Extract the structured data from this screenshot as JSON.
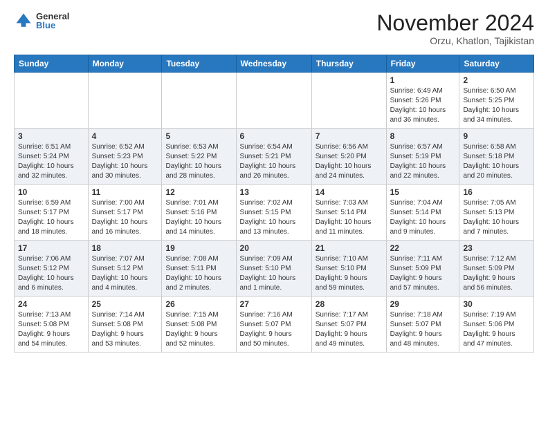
{
  "header": {
    "logo_general": "General",
    "logo_blue": "Blue",
    "month_title": "November 2024",
    "location": "Orzu, Khatlon, Tajikistan"
  },
  "weekdays": [
    "Sunday",
    "Monday",
    "Tuesday",
    "Wednesday",
    "Thursday",
    "Friday",
    "Saturday"
  ],
  "weeks": [
    [
      {
        "day": "",
        "info": ""
      },
      {
        "day": "",
        "info": ""
      },
      {
        "day": "",
        "info": ""
      },
      {
        "day": "",
        "info": ""
      },
      {
        "day": "",
        "info": ""
      },
      {
        "day": "1",
        "info": "Sunrise: 6:49 AM\nSunset: 5:26 PM\nDaylight: 10 hours\nand 36 minutes."
      },
      {
        "day": "2",
        "info": "Sunrise: 6:50 AM\nSunset: 5:25 PM\nDaylight: 10 hours\nand 34 minutes."
      }
    ],
    [
      {
        "day": "3",
        "info": "Sunrise: 6:51 AM\nSunset: 5:24 PM\nDaylight: 10 hours\nand 32 minutes."
      },
      {
        "day": "4",
        "info": "Sunrise: 6:52 AM\nSunset: 5:23 PM\nDaylight: 10 hours\nand 30 minutes."
      },
      {
        "day": "5",
        "info": "Sunrise: 6:53 AM\nSunset: 5:22 PM\nDaylight: 10 hours\nand 28 minutes."
      },
      {
        "day": "6",
        "info": "Sunrise: 6:54 AM\nSunset: 5:21 PM\nDaylight: 10 hours\nand 26 minutes."
      },
      {
        "day": "7",
        "info": "Sunrise: 6:56 AM\nSunset: 5:20 PM\nDaylight: 10 hours\nand 24 minutes."
      },
      {
        "day": "8",
        "info": "Sunrise: 6:57 AM\nSunset: 5:19 PM\nDaylight: 10 hours\nand 22 minutes."
      },
      {
        "day": "9",
        "info": "Sunrise: 6:58 AM\nSunset: 5:18 PM\nDaylight: 10 hours\nand 20 minutes."
      }
    ],
    [
      {
        "day": "10",
        "info": "Sunrise: 6:59 AM\nSunset: 5:17 PM\nDaylight: 10 hours\nand 18 minutes."
      },
      {
        "day": "11",
        "info": "Sunrise: 7:00 AM\nSunset: 5:17 PM\nDaylight: 10 hours\nand 16 minutes."
      },
      {
        "day": "12",
        "info": "Sunrise: 7:01 AM\nSunset: 5:16 PM\nDaylight: 10 hours\nand 14 minutes."
      },
      {
        "day": "13",
        "info": "Sunrise: 7:02 AM\nSunset: 5:15 PM\nDaylight: 10 hours\nand 13 minutes."
      },
      {
        "day": "14",
        "info": "Sunrise: 7:03 AM\nSunset: 5:14 PM\nDaylight: 10 hours\nand 11 minutes."
      },
      {
        "day": "15",
        "info": "Sunrise: 7:04 AM\nSunset: 5:14 PM\nDaylight: 10 hours\nand 9 minutes."
      },
      {
        "day": "16",
        "info": "Sunrise: 7:05 AM\nSunset: 5:13 PM\nDaylight: 10 hours\nand 7 minutes."
      }
    ],
    [
      {
        "day": "17",
        "info": "Sunrise: 7:06 AM\nSunset: 5:12 PM\nDaylight: 10 hours\nand 6 minutes."
      },
      {
        "day": "18",
        "info": "Sunrise: 7:07 AM\nSunset: 5:12 PM\nDaylight: 10 hours\nand 4 minutes."
      },
      {
        "day": "19",
        "info": "Sunrise: 7:08 AM\nSunset: 5:11 PM\nDaylight: 10 hours\nand 2 minutes."
      },
      {
        "day": "20",
        "info": "Sunrise: 7:09 AM\nSunset: 5:10 PM\nDaylight: 10 hours\nand 1 minute."
      },
      {
        "day": "21",
        "info": "Sunrise: 7:10 AM\nSunset: 5:10 PM\nDaylight: 9 hours\nand 59 minutes."
      },
      {
        "day": "22",
        "info": "Sunrise: 7:11 AM\nSunset: 5:09 PM\nDaylight: 9 hours\nand 57 minutes."
      },
      {
        "day": "23",
        "info": "Sunrise: 7:12 AM\nSunset: 5:09 PM\nDaylight: 9 hours\nand 56 minutes."
      }
    ],
    [
      {
        "day": "24",
        "info": "Sunrise: 7:13 AM\nSunset: 5:08 PM\nDaylight: 9 hours\nand 54 minutes."
      },
      {
        "day": "25",
        "info": "Sunrise: 7:14 AM\nSunset: 5:08 PM\nDaylight: 9 hours\nand 53 minutes."
      },
      {
        "day": "26",
        "info": "Sunrise: 7:15 AM\nSunset: 5:08 PM\nDaylight: 9 hours\nand 52 minutes."
      },
      {
        "day": "27",
        "info": "Sunrise: 7:16 AM\nSunset: 5:07 PM\nDaylight: 9 hours\nand 50 minutes."
      },
      {
        "day": "28",
        "info": "Sunrise: 7:17 AM\nSunset: 5:07 PM\nDaylight: 9 hours\nand 49 minutes."
      },
      {
        "day": "29",
        "info": "Sunrise: 7:18 AM\nSunset: 5:07 PM\nDaylight: 9 hours\nand 48 minutes."
      },
      {
        "day": "30",
        "info": "Sunrise: 7:19 AM\nSunset: 5:06 PM\nDaylight: 9 hours\nand 47 minutes."
      }
    ]
  ]
}
